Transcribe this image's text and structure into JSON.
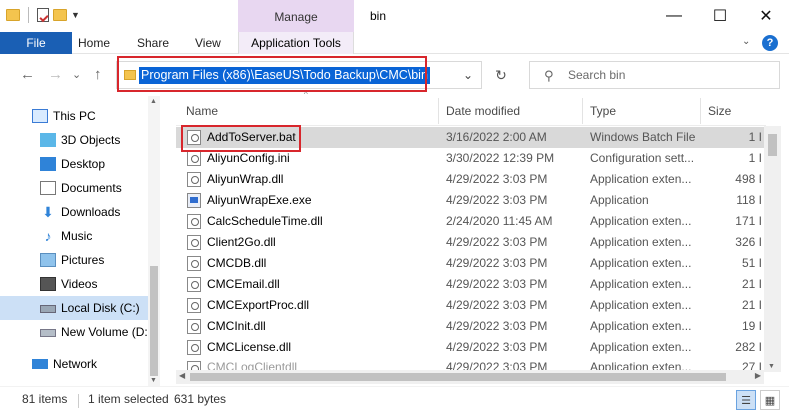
{
  "titlebar": {
    "manage_label": "Manage",
    "title": "bin",
    "minimize": "—",
    "maximize": "☐",
    "close": "✕"
  },
  "ribbon": {
    "file": "File",
    "home": "Home",
    "share": "Share",
    "view": "View",
    "app_tools": "Application Tools",
    "help": "?"
  },
  "nav": {
    "back": "←",
    "forward": "→",
    "recent": "⌄",
    "up": "↑",
    "address_path": "Program Files (x86)\\EaseUS\\Todo Backup\\CMC\\bin",
    "refresh": "↻",
    "search_placeholder": "Search bin"
  },
  "sidebar": {
    "items": [
      {
        "label": "This PC"
      },
      {
        "label": "3D Objects"
      },
      {
        "label": "Desktop"
      },
      {
        "label": "Documents"
      },
      {
        "label": "Downloads"
      },
      {
        "label": "Music"
      },
      {
        "label": "Pictures"
      },
      {
        "label": "Videos"
      },
      {
        "label": "Local Disk (C:)"
      },
      {
        "label": "New Volume (D:"
      },
      {
        "label": "Network"
      }
    ]
  },
  "columns": {
    "name": "Name",
    "date": "Date modified",
    "type": "Type",
    "size": "Size"
  },
  "files": [
    {
      "name": "AddToServer.bat",
      "date": "3/16/2022 2:00 AM",
      "type": "Windows Batch File",
      "size": "1 I"
    },
    {
      "name": "AliyunConfig.ini",
      "date": "3/30/2022 12:39 PM",
      "type": "Configuration sett...",
      "size": "1 I"
    },
    {
      "name": "AliyunWrap.dll",
      "date": "4/29/2022 3:03 PM",
      "type": "Application exten...",
      "size": "498 I"
    },
    {
      "name": "AliyunWrapExe.exe",
      "date": "4/29/2022 3:03 PM",
      "type": "Application",
      "size": "118 I"
    },
    {
      "name": "CalcScheduleTime.dll",
      "date": "2/24/2020 11:45 AM",
      "type": "Application exten...",
      "size": "171 I"
    },
    {
      "name": "Client2Go.dll",
      "date": "4/29/2022 3:03 PM",
      "type": "Application exten...",
      "size": "326 I"
    },
    {
      "name": "CMCDB.dll",
      "date": "4/29/2022 3:03 PM",
      "type": "Application exten...",
      "size": "51 I"
    },
    {
      "name": "CMCEmail.dll",
      "date": "4/29/2022 3:03 PM",
      "type": "Application exten...",
      "size": "21 I"
    },
    {
      "name": "CMCExportProc.dll",
      "date": "4/29/2022 3:03 PM",
      "type": "Application exten...",
      "size": "21 I"
    },
    {
      "name": "CMCInit.dll",
      "date": "4/29/2022 3:03 PM",
      "type": "Application exten...",
      "size": "19 I"
    },
    {
      "name": "CMCLicense.dll",
      "date": "4/29/2022 3:03 PM",
      "type": "Application exten...",
      "size": "282 I"
    },
    {
      "name": "CMCLogClientdll",
      "date": "4/29/2022 3:03 PM",
      "type": "Application exten...",
      "size": "27 I"
    }
  ],
  "status": {
    "items_count": "81 items",
    "selected": "1 item selected",
    "size": "631 bytes"
  }
}
